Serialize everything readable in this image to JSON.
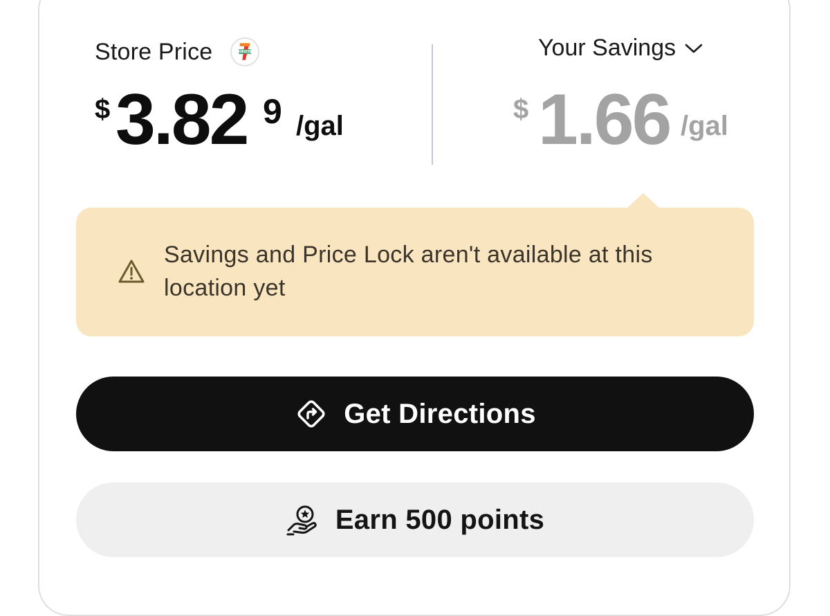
{
  "store": {
    "label": "Store Price",
    "logo_icon": "7-eleven-logo",
    "currency": "$",
    "price_main": "3.82",
    "price_fraction": "9",
    "unit": "/gal"
  },
  "savings": {
    "label": "Your Savings",
    "dropdown_icon": "chevron-down-icon",
    "currency": "$",
    "amount": "1.66",
    "unit": "/gal"
  },
  "notice": {
    "icon": "warning-icon",
    "text": "Savings and Price Lock aren't available at this location yet",
    "background": "#f9e6c1"
  },
  "actions": {
    "directions_label": "Get Directions",
    "directions_icon": "directions-icon",
    "points_label": "Earn 500 points",
    "points_icon": "rewards-hand-icon"
  },
  "colors": {
    "primary_button": "#111111",
    "secondary_button": "#efefef",
    "savings_text": "#a3a3a3",
    "logo_red": "#e8362c",
    "logo_orange": "#f58220",
    "logo_green": "#0d8a4a"
  }
}
